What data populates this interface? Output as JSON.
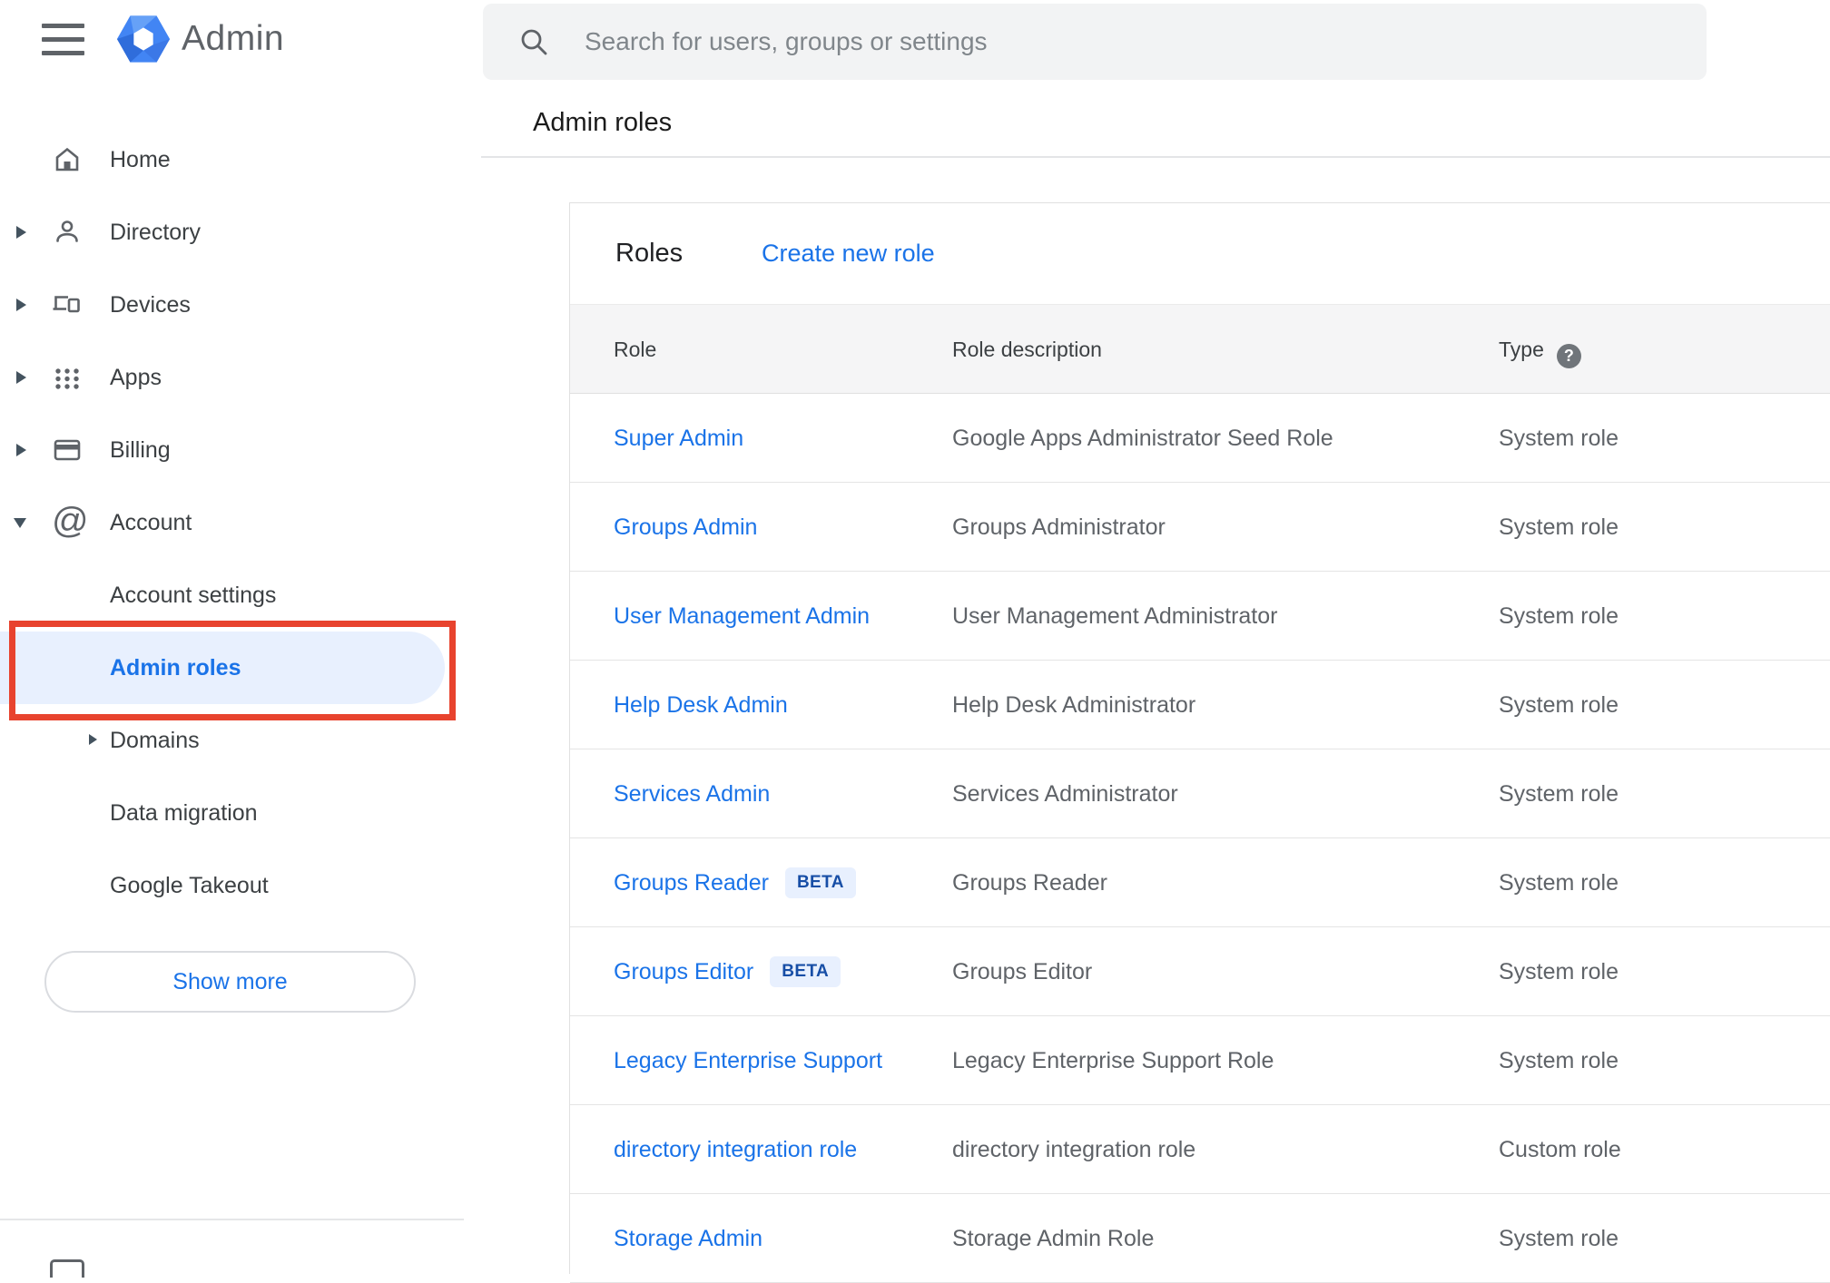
{
  "header": {
    "app_title": "Admin",
    "search_placeholder": "Search for users, groups or settings"
  },
  "page": {
    "title": "Admin roles"
  },
  "sidebar": {
    "items": [
      {
        "label": "Home",
        "icon": "home-icon"
      },
      {
        "label": "Directory",
        "icon": "person-icon",
        "caret": "right"
      },
      {
        "label": "Devices",
        "icon": "devices-icon",
        "caret": "right"
      },
      {
        "label": "Apps",
        "icon": "apps-grid-icon",
        "caret": "right"
      },
      {
        "label": "Billing",
        "icon": "credit-card-icon",
        "caret": "right"
      },
      {
        "label": "Account",
        "icon": "at-sign-icon",
        "caret": "down"
      }
    ],
    "sub_items": [
      {
        "label": "Account settings"
      },
      {
        "label": "Admin roles",
        "selected": true
      },
      {
        "label": "Domains",
        "caret": "right"
      },
      {
        "label": "Data migration"
      },
      {
        "label": "Google Takeout"
      }
    ],
    "show_more_label": "Show more"
  },
  "roles_panel": {
    "title": "Roles",
    "create_link": "Create new role",
    "columns": [
      "Role",
      "Role description",
      "Type"
    ],
    "type_help_glyph": "?",
    "rows": [
      {
        "role": "Super Admin",
        "description": "Google Apps Administrator Seed Role",
        "type": "System role"
      },
      {
        "role": "Groups Admin",
        "description": "Groups Administrator",
        "type": "System role"
      },
      {
        "role": "User Management Admin",
        "description": "User Management Administrator",
        "type": "System role"
      },
      {
        "role": "Help Desk Admin",
        "description": "Help Desk Administrator",
        "type": "System role"
      },
      {
        "role": "Services Admin",
        "description": "Services Administrator",
        "type": "System role"
      },
      {
        "role": "Groups Reader",
        "badge": "BETA",
        "description": "Groups Reader",
        "type": "System role"
      },
      {
        "role": "Groups Editor",
        "badge": "BETA",
        "description": "Groups Editor",
        "type": "System role"
      },
      {
        "role": "Legacy Enterprise Support",
        "description": "Legacy Enterprise Support Role",
        "type": "System role"
      },
      {
        "role": "directory integration role",
        "description": "directory integration role",
        "type": "Custom role"
      },
      {
        "role": "Storage Admin",
        "description": "Storage Admin Role",
        "type": "System role"
      }
    ]
  },
  "colors": {
    "link_blue": "#1a73e8",
    "selected_bg": "#e8f0fe",
    "beta_text": "#174ea6",
    "annotation_red": "#e8432e",
    "header_row_bg": "#f5f5f6",
    "search_bg": "#f2f3f4",
    "text_primary": "#202124",
    "text_secondary": "#5f6368",
    "logo_blue": "#4285f4"
  }
}
